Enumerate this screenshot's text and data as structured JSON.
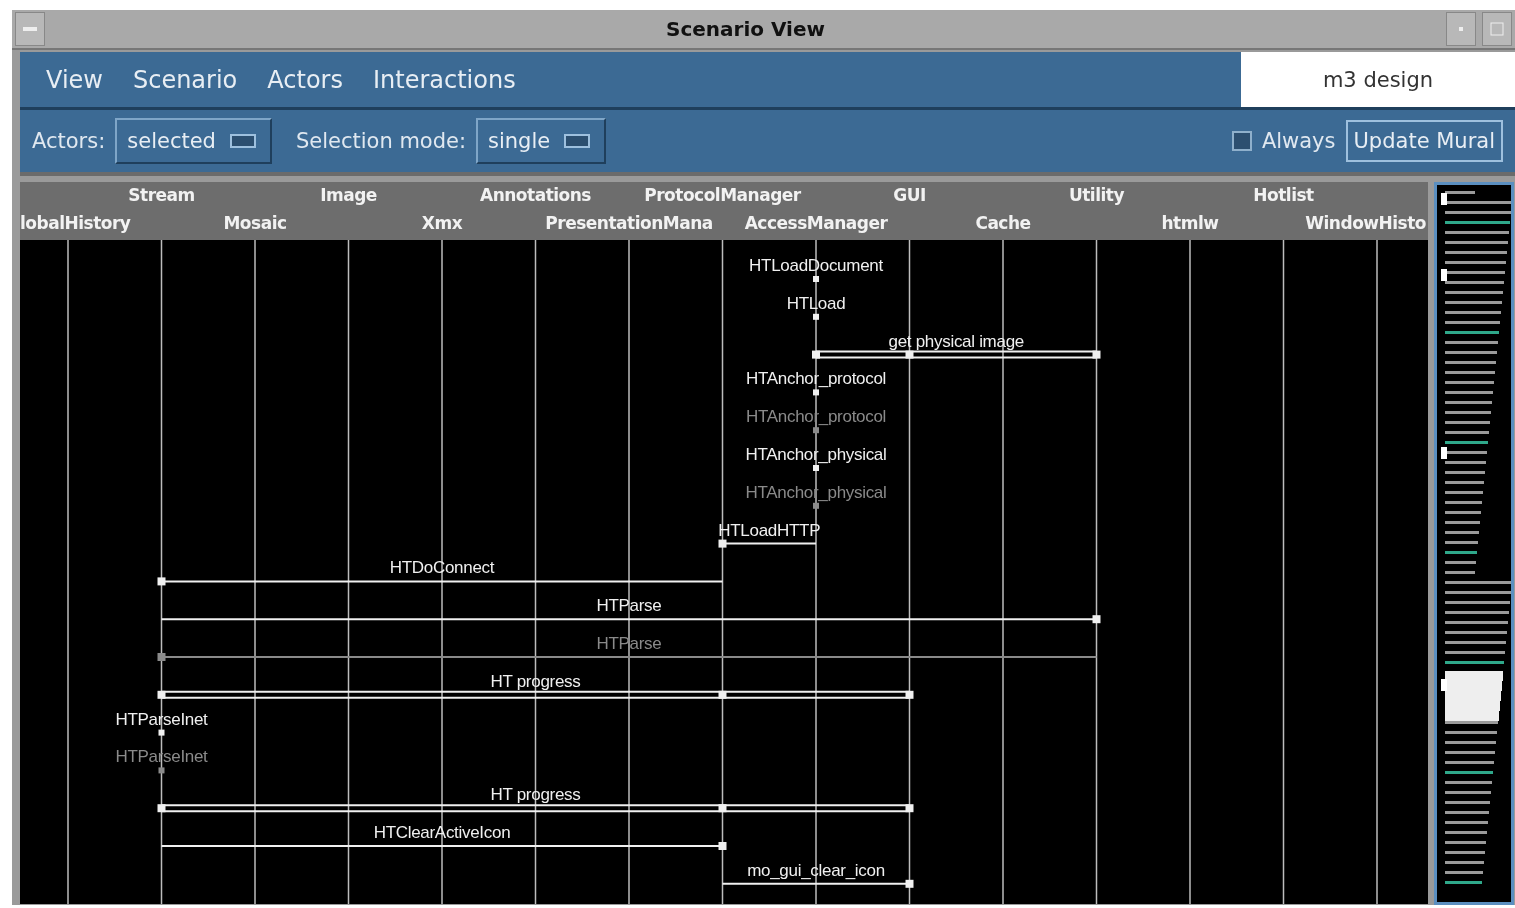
{
  "window": {
    "title": "Scenario View"
  },
  "menu": [
    {
      "label": "View"
    },
    {
      "label": "Scenario"
    },
    {
      "label": "Actors"
    },
    {
      "label": "Interactions"
    }
  ],
  "design_name": "m3 design",
  "toolbar": {
    "actors_label": "Actors:",
    "actors_value": "selected",
    "selection_mode_label": "Selection mode:",
    "selection_mode_value": "single",
    "always": {
      "label": "Always",
      "checked": false
    },
    "update_button": "Update Mural"
  },
  "actors": [
    {
      "name": "lobalHistory"
    },
    {
      "name": "Stream"
    },
    {
      "name": "Mosaic"
    },
    {
      "name": "Image"
    },
    {
      "name": "Xmx"
    },
    {
      "name": "Annotations"
    },
    {
      "name": "PresentationMana"
    },
    {
      "name": "ProtocolManager"
    },
    {
      "name": "AccessManager"
    },
    {
      "name": "GUI"
    },
    {
      "name": "Cache"
    },
    {
      "name": "Utility"
    },
    {
      "name": "htmlw"
    },
    {
      "name": "Hotlist"
    },
    {
      "name": "WindowHisto"
    }
  ],
  "messages": [
    {
      "label": "HTLoadDocument",
      "kind": "self",
      "dimmed": false
    },
    {
      "label": "HTLoad",
      "kind": "self",
      "dimmed": false
    },
    {
      "label": "get physical image",
      "kind": "double",
      "dimmed": false
    },
    {
      "label": "HTAnchor_protocol",
      "kind": "self",
      "dimmed": false
    },
    {
      "label": "HTAnchor_protocol",
      "kind": "self",
      "dimmed": true
    },
    {
      "label": "HTAnchor_physical",
      "kind": "self",
      "dimmed": false
    },
    {
      "label": "HTAnchor_physical",
      "kind": "self",
      "dimmed": true
    },
    {
      "label": "HTLoadHTTP",
      "kind": "call",
      "dimmed": false
    },
    {
      "label": "HTDoConnect",
      "kind": "call",
      "dimmed": false
    },
    {
      "label": "HTParse",
      "kind": "call",
      "dimmed": false
    },
    {
      "label": "HTParse",
      "kind": "call",
      "dimmed": true
    },
    {
      "label": "HT progress",
      "kind": "double",
      "dimmed": false
    },
    {
      "label": "HTParseInet",
      "kind": "self",
      "dimmed": false
    },
    {
      "label": "HTParseInet",
      "kind": "self",
      "dimmed": true
    },
    {
      "label": "HT progress",
      "kind": "double",
      "dimmed": false
    },
    {
      "label": "HTClearActiveIcon",
      "kind": "call",
      "dimmed": false
    },
    {
      "label": "mo_gui_clear_icon",
      "kind": "call",
      "dimmed": false
    }
  ]
}
